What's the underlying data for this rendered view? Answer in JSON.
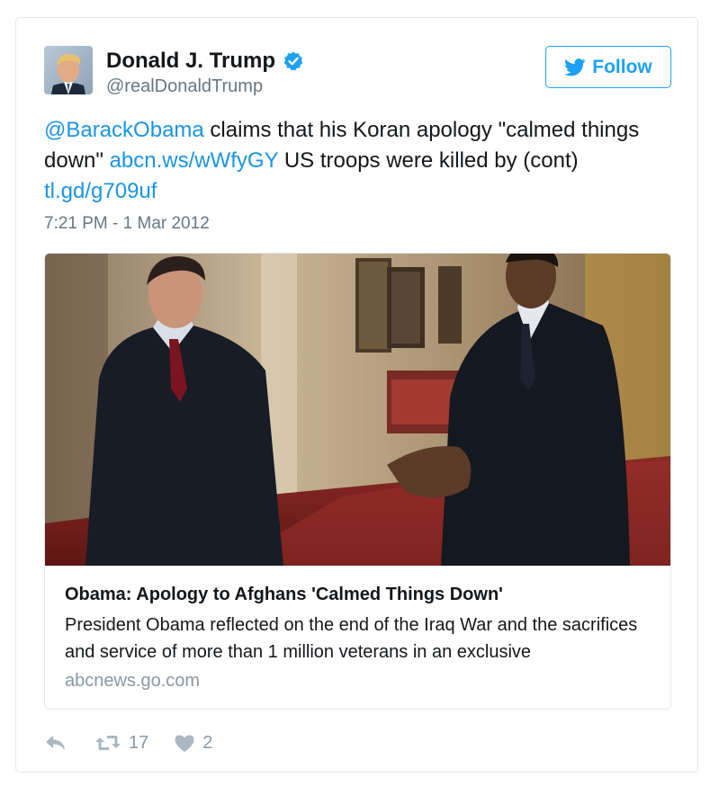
{
  "author": {
    "display_name": "Donald J. Trump",
    "screen_name": "@realDonaldTrump",
    "verified_icon": "verified-badge-icon"
  },
  "follow_button": {
    "label": "Follow",
    "icon": "twitter-bird-icon"
  },
  "tweet": {
    "mention": "@BarackObama",
    "text_part1": " claims that his Koran apology \"calmed things down\" ",
    "link1": "abcn.ws/wWfyGY",
    "text_part2": " US troops were killed by (cont) ",
    "link2": "tl.gd/g709uf",
    "timestamp": "7:21 PM - 1 Mar 2012"
  },
  "link_card": {
    "title": "Obama: Apology to Afghans 'Calmed Things Down'",
    "description": "President Obama reflected on the end of the Iraq War and the sacrifices and service of more than 1 million veterans in an exclusive",
    "domain": "abcnews.go.com"
  },
  "actions": {
    "reply_icon": "reply-icon",
    "retweet_icon": "retweet-icon",
    "retweet_count": "17",
    "like_icon": "heart-icon",
    "like_count": "2"
  },
  "colors": {
    "link_blue": "#1b95e0",
    "follow_blue": "#1da1f2",
    "secondary_text": "#657786",
    "border": "#e1e8ed"
  }
}
